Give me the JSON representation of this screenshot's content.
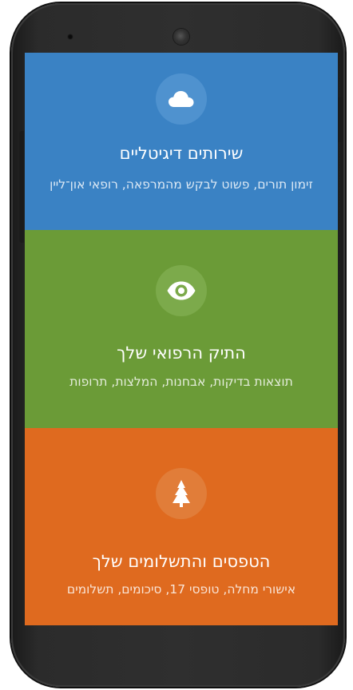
{
  "panels": [
    {
      "icon": "cloud-icon",
      "title": "שירותים דיגיטליים",
      "subtitle": "זימון תורים, פשוט לבקש מהמרפאה, רופאי און־ליין",
      "color": "#3a82c4"
    },
    {
      "icon": "eye-icon",
      "title": "התיק הרפואי שלך",
      "subtitle": "תוצאות בדיקות, אבחנות, המלצות, תרופות",
      "color": "#6b9b37"
    },
    {
      "icon": "tree-icon",
      "title": "הטפסים והתשלומים שלך",
      "subtitle": "אישורי מחלה, טופסי 17, סיכומים, תשלומים",
      "color": "#df6a1f"
    }
  ]
}
